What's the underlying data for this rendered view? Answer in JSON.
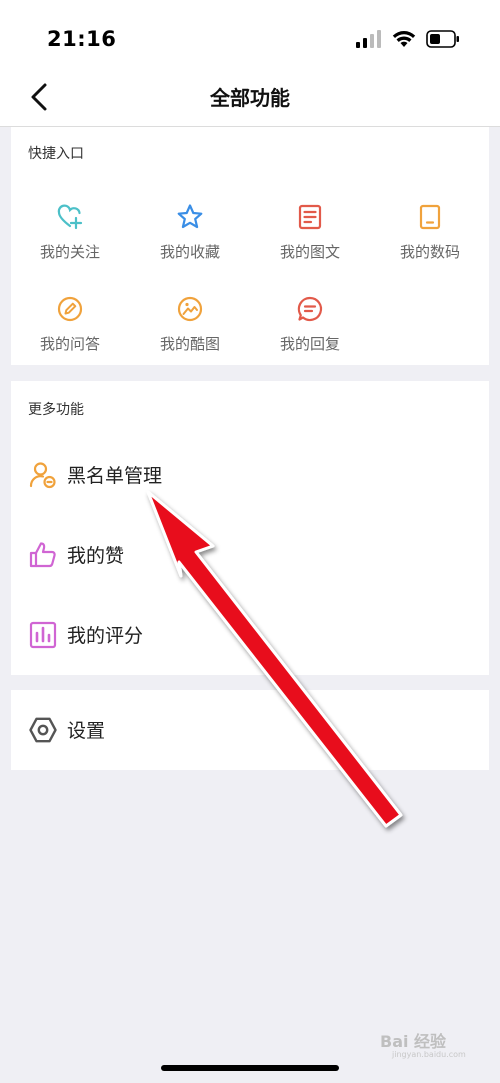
{
  "status_bar": {
    "time": "21:16"
  },
  "nav": {
    "title": "全部功能"
  },
  "quick_entry": {
    "title": "快捷入口",
    "items": [
      {
        "label": "我的关注",
        "icon": "heart-plus-icon"
      },
      {
        "label": "我的收藏",
        "icon": "star-icon"
      },
      {
        "label": "我的图文",
        "icon": "document-icon"
      },
      {
        "label": "我的数码",
        "icon": "tablet-icon"
      },
      {
        "label": "我的问答",
        "icon": "pencil-circle-icon"
      },
      {
        "label": "我的酷图",
        "icon": "image-circle-icon"
      },
      {
        "label": "我的回复",
        "icon": "chat-bubble-icon"
      }
    ]
  },
  "more_functions": {
    "title": "更多功能",
    "items": [
      {
        "label": "黑名单管理",
        "icon": "user-block-icon"
      },
      {
        "label": "我的赞",
        "icon": "thumbs-up-icon"
      },
      {
        "label": "我的评分",
        "icon": "bar-chart-icon"
      }
    ]
  },
  "settings": {
    "label": "设置",
    "icon": "hexagon-settings-icon"
  },
  "watermark": {
    "text": "Bai 经验",
    "sub": "jingyan.baidu.com"
  },
  "colors": {
    "teal": "#4cc0c8",
    "blue": "#3a8ee6",
    "red": "#e25a4a",
    "orange": "#f0a23c",
    "purple": "#d065d3",
    "arrow": "#e8101a"
  }
}
